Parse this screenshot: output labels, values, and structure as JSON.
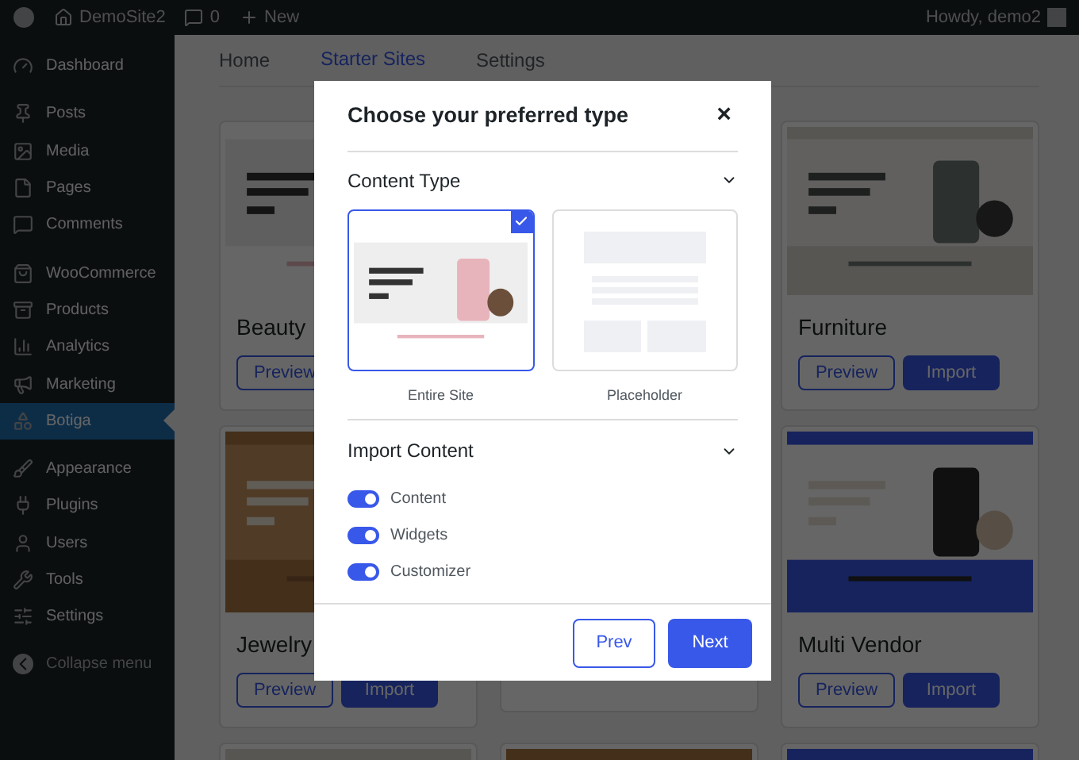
{
  "admin_bar": {
    "site": "DemoSite2",
    "comments": "0",
    "new": "New",
    "greeting": "Howdy, demo2"
  },
  "sidebar": {
    "groups": [
      {
        "items": [
          {
            "label": "Dashboard",
            "selected": false
          }
        ]
      },
      {
        "items": [
          {
            "label": "Posts",
            "selected": false
          },
          {
            "label": "Media",
            "selected": false
          },
          {
            "label": "Pages",
            "selected": false
          },
          {
            "label": "Comments",
            "selected": false
          }
        ]
      },
      {
        "items": [
          {
            "label": "WooCommerce",
            "selected": false
          },
          {
            "label": "Products",
            "selected": false
          },
          {
            "label": "Analytics",
            "selected": false
          },
          {
            "label": "Marketing",
            "selected": false
          },
          {
            "label": "Botiga",
            "selected": true
          }
        ]
      },
      {
        "items": [
          {
            "label": "Appearance",
            "selected": false
          },
          {
            "label": "Plugins",
            "selected": false
          },
          {
            "label": "Users",
            "selected": false
          },
          {
            "label": "Tools",
            "selected": false
          },
          {
            "label": "Settings",
            "selected": false
          }
        ]
      }
    ],
    "collapse": "Collapse menu"
  },
  "tabs": [
    {
      "label": "Home",
      "selected": false
    },
    {
      "label": "Starter Sites",
      "selected": true
    },
    {
      "label": "Settings",
      "selected": false
    }
  ],
  "sites": [
    {
      "title": "Beauty",
      "preview": "Preview"
    },
    {
      "title": "Furniture",
      "preview": "Preview",
      "import": "Import"
    },
    {
      "title": "Jewelry",
      "preview": "Preview",
      "import": "Import"
    },
    {
      "title": "Multi Vendor",
      "preview": "Preview",
      "import": "Import"
    }
  ],
  "modal": {
    "title": "Choose your preferred type",
    "close": "×",
    "content_type": {
      "heading": "Content Type",
      "expanded": true,
      "options": [
        {
          "label": "Entire Site",
          "kind": "site",
          "selected": true
        },
        {
          "label": "Placeholder",
          "kind": "placeholder",
          "selected": false
        }
      ]
    },
    "import_content": {
      "heading": "Import Content",
      "expanded": true,
      "toggles": [
        {
          "label": "Content",
          "on": true
        },
        {
          "label": "Widgets",
          "on": true
        },
        {
          "label": "Customizer",
          "on": true
        }
      ]
    },
    "buttons": {
      "prev": "Prev",
      "next": "Next"
    }
  }
}
